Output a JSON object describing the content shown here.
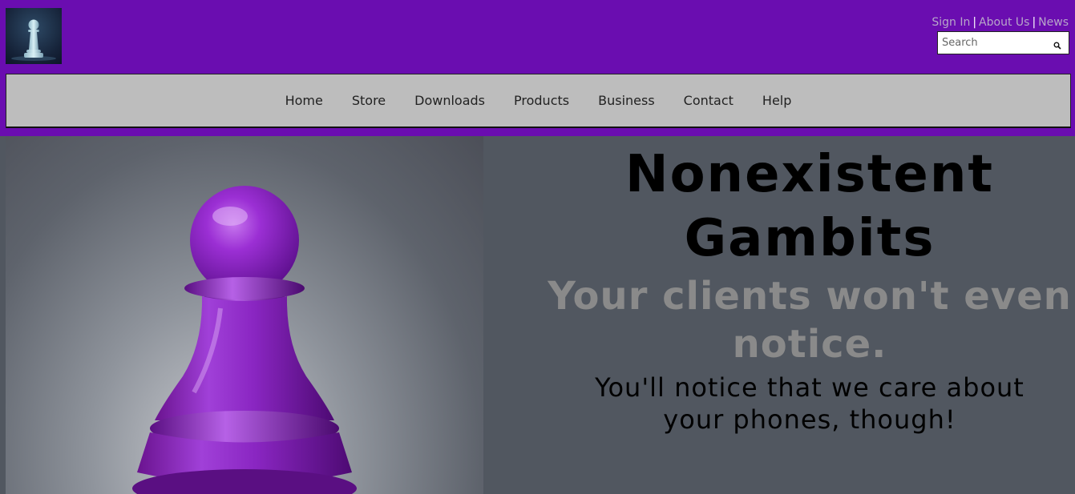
{
  "header": {
    "logo_icon": "pawn-icon",
    "links": [
      {
        "label": "Sign In"
      },
      {
        "label": "About Us"
      },
      {
        "label": "News"
      }
    ],
    "link_separator": "|",
    "search": {
      "placeholder": "Search",
      "value": "",
      "icon": "search-icon"
    }
  },
  "nav": {
    "items": [
      {
        "label": "Home"
      },
      {
        "label": "Store"
      },
      {
        "label": "Downloads"
      },
      {
        "label": "Products"
      },
      {
        "label": "Business"
      },
      {
        "label": "Contact"
      },
      {
        "label": "Help"
      }
    ]
  },
  "hero": {
    "image_icon": "purple-pawn-image",
    "title": "Nonexistent Gambits",
    "subtitle": "Your clients won't even notice.",
    "body": "You'll notice that we care about your phones, though!"
  },
  "colors": {
    "brand_purple": "#6a0db0",
    "nav_bg": "#bdbdbd",
    "hero_bg": "#515760",
    "link_color": "#b7a7c9",
    "subtitle_gray": "#8a8a8a"
  }
}
